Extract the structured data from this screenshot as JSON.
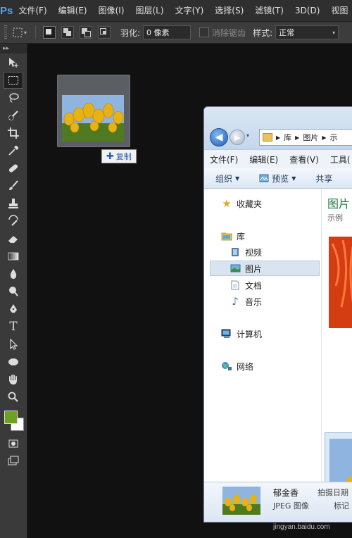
{
  "menubar": {
    "logo": "Ps",
    "items": [
      "文件(F)",
      "编辑(E)",
      "图像(I)",
      "图层(L)",
      "文字(Y)",
      "选择(S)",
      "滤镜(T)",
      "3D(D)",
      "视图"
    ]
  },
  "options": {
    "feather_label": "羽化:",
    "feather_value": "0 像素",
    "antialias_label": "消除锯齿",
    "style_label": "样式:",
    "style_value": "正常"
  },
  "toolbox": {
    "tools": [
      "move-icon",
      "marquee-icon",
      "lasso-icon",
      "quick-select-icon",
      "crop-icon",
      "eyedropper-icon",
      "healing-brush-icon",
      "brush-icon",
      "stamp-icon",
      "history-brush-icon",
      "eraser-icon",
      "gradient-icon",
      "blur-icon",
      "dodge-icon",
      "pen-icon",
      "type-icon",
      "path-select-icon",
      "ellipse-icon",
      "hand-icon",
      "zoom-icon"
    ],
    "foreground_color": "#6ea120",
    "background_color": "#ffffff"
  },
  "drag": {
    "badge_label": "复制"
  },
  "explorer": {
    "address": [
      "库",
      "图片",
      "示"
    ],
    "menu": [
      "文件(F)",
      "编辑(E)",
      "查看(V)",
      "工具("
    ],
    "commands": [
      "组织",
      "预览",
      "共享"
    ],
    "nav": {
      "favorites": "收藏夹",
      "libraries": "库",
      "videos": "视频",
      "pictures": "图片",
      "documents": "文档",
      "music": "音乐",
      "computer": "计算机",
      "network": "网络"
    },
    "content_title": "图片",
    "content_sub": "示例",
    "details": {
      "name": "郁金香",
      "type": "JPEG 图像",
      "date_label": "拍摄日期",
      "tags_label": "标记"
    }
  },
  "watermark": "jingyan.baidu.com"
}
